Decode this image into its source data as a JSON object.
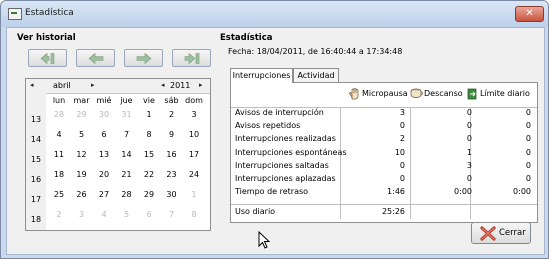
{
  "window": {
    "title": "Estadística",
    "close_glyph": "✕"
  },
  "history": {
    "section_title": "Ver historial",
    "nav_buttons": [
      {
        "icon": "first-page-icon"
      },
      {
        "icon": "previous-arrow-icon"
      },
      {
        "icon": "next-arrow-icon"
      },
      {
        "icon": "last-page-icon"
      }
    ],
    "calendar": {
      "month": "abril",
      "year": "2011",
      "prev_glyph": "◂",
      "next_glyph": "▸",
      "weekday_headers": [
        "lun",
        "mar",
        "mié",
        "jue",
        "vie",
        "sáb",
        "dom"
      ],
      "weeks": [
        {
          "week": "13",
          "days": [
            {
              "d": "28",
              "dim": true
            },
            {
              "d": "29",
              "dim": true
            },
            {
              "d": "30",
              "dim": true
            },
            {
              "d": "31",
              "dim": true
            },
            {
              "d": "1"
            },
            {
              "d": "2"
            },
            {
              "d": "3"
            }
          ]
        },
        {
          "week": "14",
          "days": [
            {
              "d": "4"
            },
            {
              "d": "5"
            },
            {
              "d": "6"
            },
            {
              "d": "7"
            },
            {
              "d": "8"
            },
            {
              "d": "9"
            },
            {
              "d": "10"
            }
          ]
        },
        {
          "week": "15",
          "days": [
            {
              "d": "11"
            },
            {
              "d": "12"
            },
            {
              "d": "13"
            },
            {
              "d": "14"
            },
            {
              "d": "15"
            },
            {
              "d": "16"
            },
            {
              "d": "17"
            }
          ]
        },
        {
          "week": "16",
          "days": [
            {
              "d": "18"
            },
            {
              "d": "19"
            },
            {
              "d": "20"
            },
            {
              "d": "21"
            },
            {
              "d": "22"
            },
            {
              "d": "23"
            },
            {
              "d": "24"
            }
          ]
        },
        {
          "week": "17",
          "days": [
            {
              "d": "25"
            },
            {
              "d": "26"
            },
            {
              "d": "27"
            },
            {
              "d": "28"
            },
            {
              "d": "29"
            },
            {
              "d": "30"
            },
            {
              "d": "1",
              "dim": true
            }
          ]
        },
        {
          "week": "18",
          "days": [
            {
              "d": "2",
              "dim": true
            },
            {
              "d": "3",
              "dim": true
            },
            {
              "d": "4",
              "dim": true
            },
            {
              "d": "5",
              "dim": true
            },
            {
              "d": "6",
              "dim": true
            },
            {
              "d": "7",
              "dim": true
            },
            {
              "d": "8",
              "dim": true
            }
          ]
        }
      ]
    }
  },
  "stats": {
    "section_title": "Estadística",
    "date_range": "Fecha:  18/04/2011, de 16:40:44 a 17:34:48",
    "tabs": [
      {
        "label": "Interrupciones",
        "active": true
      },
      {
        "label": "Actividad",
        "active": false
      }
    ],
    "columns": [
      {
        "label": "Micropausa",
        "icon": "hand-icon"
      },
      {
        "label": "Descanso",
        "icon": "coffee-cup-icon"
      },
      {
        "label": "Límite diario",
        "icon": "exit-door-icon"
      }
    ],
    "rows": [
      {
        "label": "Avisos de interrupción",
        "values": [
          "3",
          "0",
          "0"
        ]
      },
      {
        "label": "Avisos repetidos",
        "values": [
          "0",
          "0",
          "0"
        ]
      },
      {
        "label": "Interrupciones realizadas",
        "values": [
          "2",
          "0",
          "0"
        ]
      },
      {
        "label": "Interrupciones espontáneas",
        "values": [
          "10",
          "1",
          "0"
        ]
      },
      {
        "label": "Interrupciones saltadas",
        "values": [
          "0",
          "3",
          "0"
        ]
      },
      {
        "label": "Interrupciones aplazadas",
        "values": [
          "0",
          "0",
          "0"
        ]
      },
      {
        "label": "Tiempo de retraso",
        "values": [
          "1:46",
          "0:00",
          "0:00"
        ]
      }
    ],
    "daily": {
      "label": "Uso diario",
      "value": "25:26"
    }
  },
  "close_button": {
    "label": "Cerrar",
    "icon": "red-x-icon"
  },
  "colors": {
    "accent": "#c8523e",
    "title_bar": "#bcd0ea",
    "dialog_bg": "#f0f0f0"
  }
}
